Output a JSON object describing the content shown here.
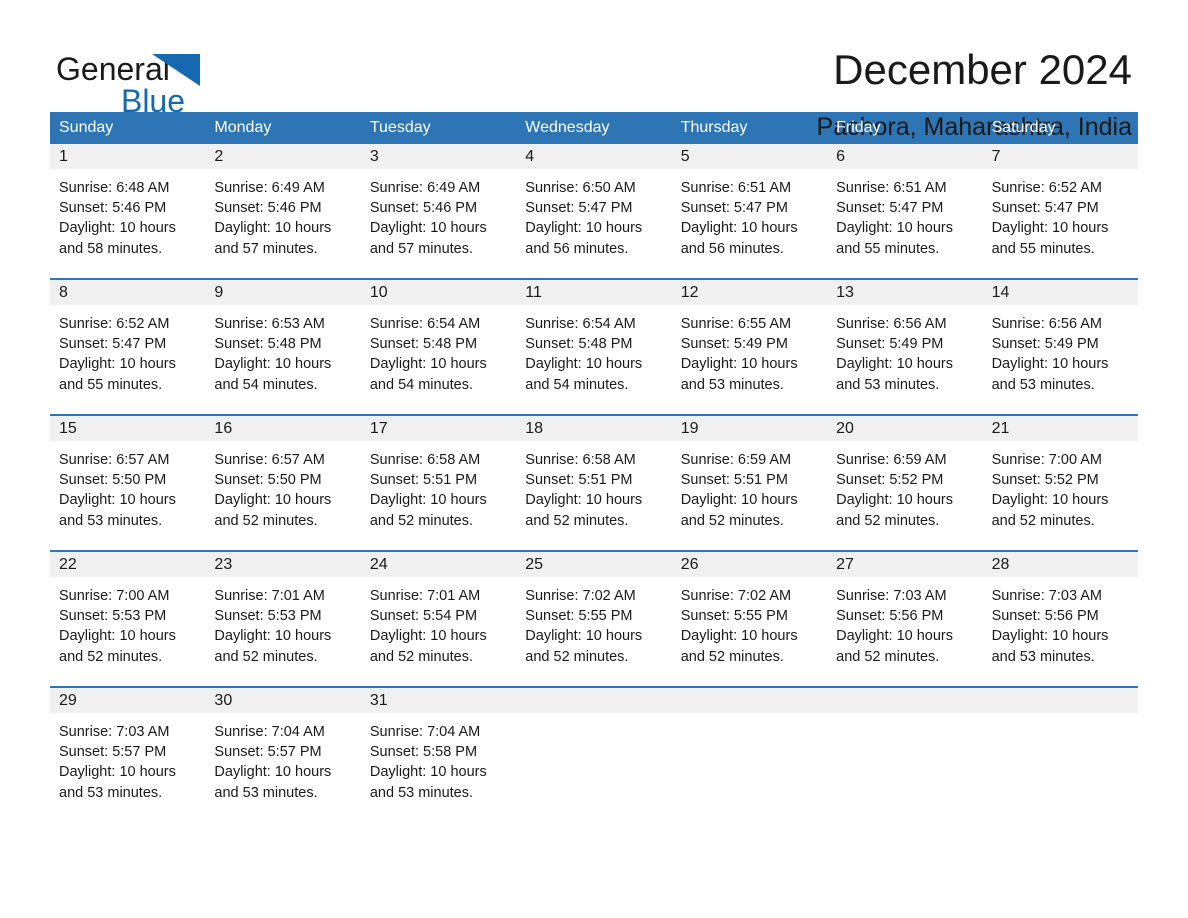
{
  "brand": {
    "name_line1": "General",
    "name_line2": "Blue",
    "accent_color": "#1569b0",
    "logo_icon": "triangle-flag-icon"
  },
  "header": {
    "title": "December 2024",
    "subtitle": "Pachora, Maharashtra, India"
  },
  "calendar": {
    "header_color": "#2e75b6",
    "weekdays": [
      "Sunday",
      "Monday",
      "Tuesday",
      "Wednesday",
      "Thursday",
      "Friday",
      "Saturday"
    ],
    "weeks": [
      [
        {
          "day": "1",
          "sunrise": "Sunrise: 6:48 AM",
          "sunset": "Sunset: 5:46 PM",
          "daylight_line1": "Daylight: 10 hours",
          "daylight_line2": "and 58 minutes."
        },
        {
          "day": "2",
          "sunrise": "Sunrise: 6:49 AM",
          "sunset": "Sunset: 5:46 PM",
          "daylight_line1": "Daylight: 10 hours",
          "daylight_line2": "and 57 minutes."
        },
        {
          "day": "3",
          "sunrise": "Sunrise: 6:49 AM",
          "sunset": "Sunset: 5:46 PM",
          "daylight_line1": "Daylight: 10 hours",
          "daylight_line2": "and 57 minutes."
        },
        {
          "day": "4",
          "sunrise": "Sunrise: 6:50 AM",
          "sunset": "Sunset: 5:47 PM",
          "daylight_line1": "Daylight: 10 hours",
          "daylight_line2": "and 56 minutes."
        },
        {
          "day": "5",
          "sunrise": "Sunrise: 6:51 AM",
          "sunset": "Sunset: 5:47 PM",
          "daylight_line1": "Daylight: 10 hours",
          "daylight_line2": "and 56 minutes."
        },
        {
          "day": "6",
          "sunrise": "Sunrise: 6:51 AM",
          "sunset": "Sunset: 5:47 PM",
          "daylight_line1": "Daylight: 10 hours",
          "daylight_line2": "and 55 minutes."
        },
        {
          "day": "7",
          "sunrise": "Sunrise: 6:52 AM",
          "sunset": "Sunset: 5:47 PM",
          "daylight_line1": "Daylight: 10 hours",
          "daylight_line2": "and 55 minutes."
        }
      ],
      [
        {
          "day": "8",
          "sunrise": "Sunrise: 6:52 AM",
          "sunset": "Sunset: 5:47 PM",
          "daylight_line1": "Daylight: 10 hours",
          "daylight_line2": "and 55 minutes."
        },
        {
          "day": "9",
          "sunrise": "Sunrise: 6:53 AM",
          "sunset": "Sunset: 5:48 PM",
          "daylight_line1": "Daylight: 10 hours",
          "daylight_line2": "and 54 minutes."
        },
        {
          "day": "10",
          "sunrise": "Sunrise: 6:54 AM",
          "sunset": "Sunset: 5:48 PM",
          "daylight_line1": "Daylight: 10 hours",
          "daylight_line2": "and 54 minutes."
        },
        {
          "day": "11",
          "sunrise": "Sunrise: 6:54 AM",
          "sunset": "Sunset: 5:48 PM",
          "daylight_line1": "Daylight: 10 hours",
          "daylight_line2": "and 54 minutes."
        },
        {
          "day": "12",
          "sunrise": "Sunrise: 6:55 AM",
          "sunset": "Sunset: 5:49 PM",
          "daylight_line1": "Daylight: 10 hours",
          "daylight_line2": "and 53 minutes."
        },
        {
          "day": "13",
          "sunrise": "Sunrise: 6:56 AM",
          "sunset": "Sunset: 5:49 PM",
          "daylight_line1": "Daylight: 10 hours",
          "daylight_line2": "and 53 minutes."
        },
        {
          "day": "14",
          "sunrise": "Sunrise: 6:56 AM",
          "sunset": "Sunset: 5:49 PM",
          "daylight_line1": "Daylight: 10 hours",
          "daylight_line2": "and 53 minutes."
        }
      ],
      [
        {
          "day": "15",
          "sunrise": "Sunrise: 6:57 AM",
          "sunset": "Sunset: 5:50 PM",
          "daylight_line1": "Daylight: 10 hours",
          "daylight_line2": "and 53 minutes."
        },
        {
          "day": "16",
          "sunrise": "Sunrise: 6:57 AM",
          "sunset": "Sunset: 5:50 PM",
          "daylight_line1": "Daylight: 10 hours",
          "daylight_line2": "and 52 minutes."
        },
        {
          "day": "17",
          "sunrise": "Sunrise: 6:58 AM",
          "sunset": "Sunset: 5:51 PM",
          "daylight_line1": "Daylight: 10 hours",
          "daylight_line2": "and 52 minutes."
        },
        {
          "day": "18",
          "sunrise": "Sunrise: 6:58 AM",
          "sunset": "Sunset: 5:51 PM",
          "daylight_line1": "Daylight: 10 hours",
          "daylight_line2": "and 52 minutes."
        },
        {
          "day": "19",
          "sunrise": "Sunrise: 6:59 AM",
          "sunset": "Sunset: 5:51 PM",
          "daylight_line1": "Daylight: 10 hours",
          "daylight_line2": "and 52 minutes."
        },
        {
          "day": "20",
          "sunrise": "Sunrise: 6:59 AM",
          "sunset": "Sunset: 5:52 PM",
          "daylight_line1": "Daylight: 10 hours",
          "daylight_line2": "and 52 minutes."
        },
        {
          "day": "21",
          "sunrise": "Sunrise: 7:00 AM",
          "sunset": "Sunset: 5:52 PM",
          "daylight_line1": "Daylight: 10 hours",
          "daylight_line2": "and 52 minutes."
        }
      ],
      [
        {
          "day": "22",
          "sunrise": "Sunrise: 7:00 AM",
          "sunset": "Sunset: 5:53 PM",
          "daylight_line1": "Daylight: 10 hours",
          "daylight_line2": "and 52 minutes."
        },
        {
          "day": "23",
          "sunrise": "Sunrise: 7:01 AM",
          "sunset": "Sunset: 5:53 PM",
          "daylight_line1": "Daylight: 10 hours",
          "daylight_line2": "and 52 minutes."
        },
        {
          "day": "24",
          "sunrise": "Sunrise: 7:01 AM",
          "sunset": "Sunset: 5:54 PM",
          "daylight_line1": "Daylight: 10 hours",
          "daylight_line2": "and 52 minutes."
        },
        {
          "day": "25",
          "sunrise": "Sunrise: 7:02 AM",
          "sunset": "Sunset: 5:55 PM",
          "daylight_line1": "Daylight: 10 hours",
          "daylight_line2": "and 52 minutes."
        },
        {
          "day": "26",
          "sunrise": "Sunrise: 7:02 AM",
          "sunset": "Sunset: 5:55 PM",
          "daylight_line1": "Daylight: 10 hours",
          "daylight_line2": "and 52 minutes."
        },
        {
          "day": "27",
          "sunrise": "Sunrise: 7:03 AM",
          "sunset": "Sunset: 5:56 PM",
          "daylight_line1": "Daylight: 10 hours",
          "daylight_line2": "and 52 minutes."
        },
        {
          "day": "28",
          "sunrise": "Sunrise: 7:03 AM",
          "sunset": "Sunset: 5:56 PM",
          "daylight_line1": "Daylight: 10 hours",
          "daylight_line2": "and 53 minutes."
        }
      ],
      [
        {
          "day": "29",
          "sunrise": "Sunrise: 7:03 AM",
          "sunset": "Sunset: 5:57 PM",
          "daylight_line1": "Daylight: 10 hours",
          "daylight_line2": "and 53 minutes."
        },
        {
          "day": "30",
          "sunrise": "Sunrise: 7:04 AM",
          "sunset": "Sunset: 5:57 PM",
          "daylight_line1": "Daylight: 10 hours",
          "daylight_line2": "and 53 minutes."
        },
        {
          "day": "31",
          "sunrise": "Sunrise: 7:04 AM",
          "sunset": "Sunset: 5:58 PM",
          "daylight_line1": "Daylight: 10 hours",
          "daylight_line2": "and 53 minutes."
        },
        {
          "day": "",
          "sunrise": "",
          "sunset": "",
          "daylight_line1": "",
          "daylight_line2": ""
        },
        {
          "day": "",
          "sunrise": "",
          "sunset": "",
          "daylight_line1": "",
          "daylight_line2": ""
        },
        {
          "day": "",
          "sunrise": "",
          "sunset": "",
          "daylight_line1": "",
          "daylight_line2": ""
        },
        {
          "day": "",
          "sunrise": "",
          "sunset": "",
          "daylight_line1": "",
          "daylight_line2": ""
        }
      ]
    ]
  }
}
